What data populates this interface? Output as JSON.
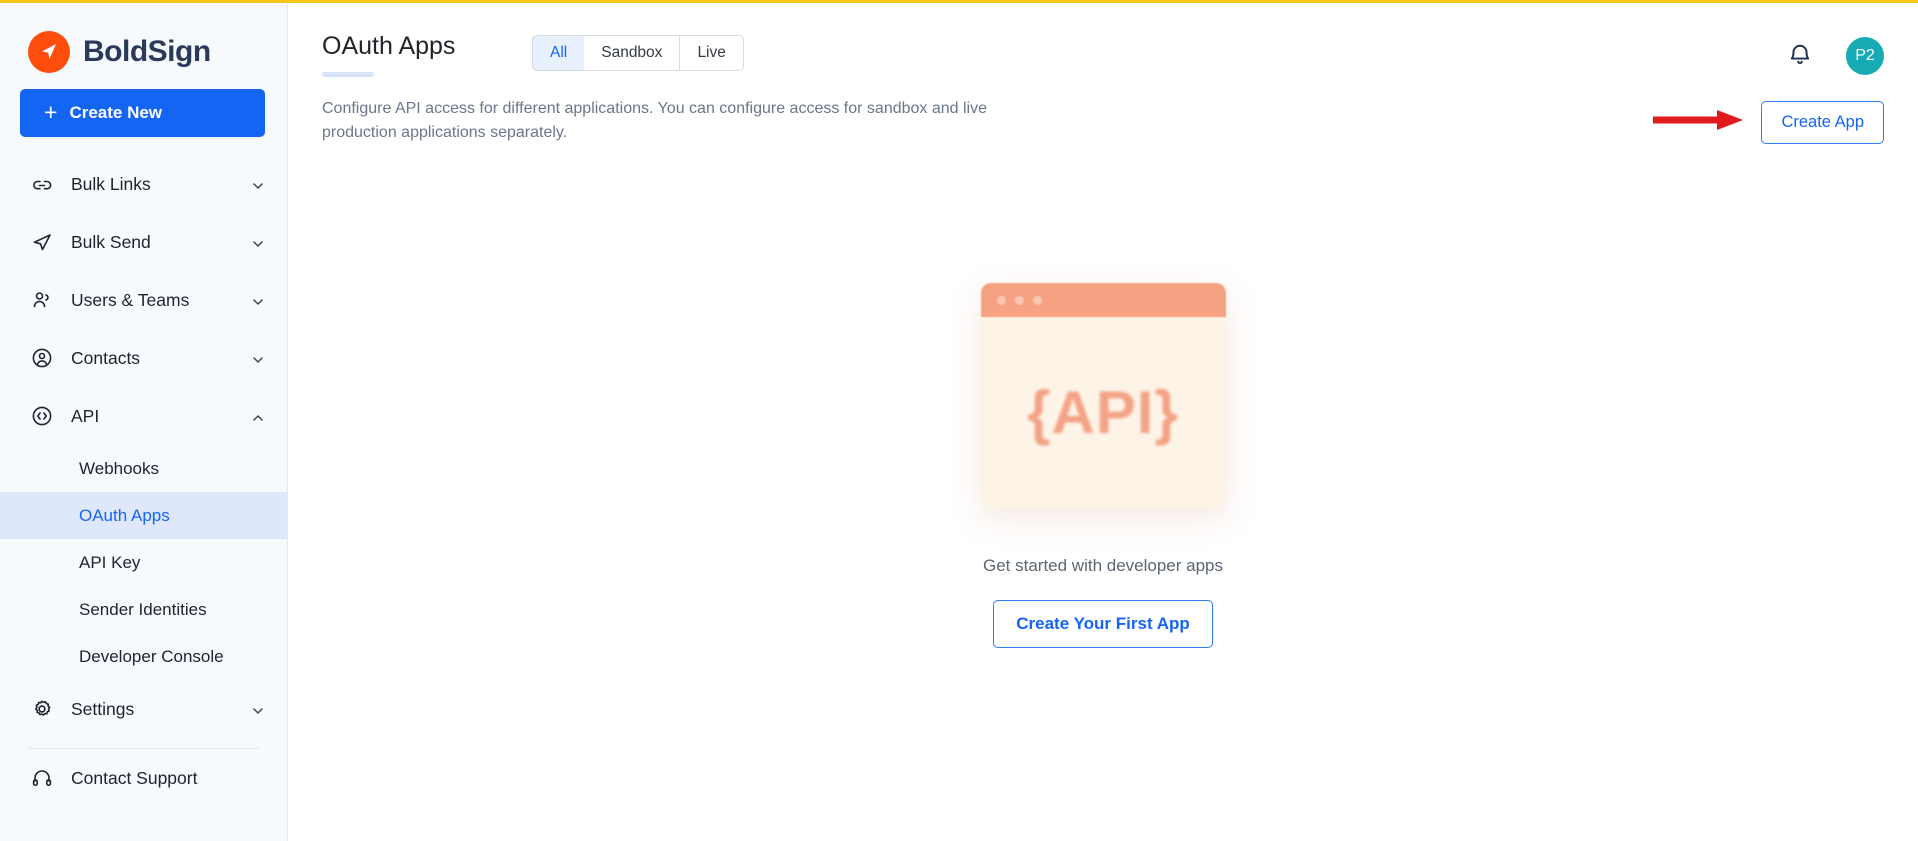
{
  "brand": {
    "name": "BoldSign",
    "logo_icon": "boldsign-arrow-logo"
  },
  "sidebar": {
    "create_new_label": "Create New",
    "items": [
      {
        "label": "Bulk Links",
        "icon": "link-icon",
        "expandable": true
      },
      {
        "label": "Bulk Send",
        "icon": "paper-plane-icon",
        "expandable": true
      },
      {
        "label": "Users & Teams",
        "icon": "users-icon",
        "expandable": true
      },
      {
        "label": "Contacts",
        "icon": "contact-person-icon",
        "expandable": true
      },
      {
        "label": "API",
        "icon": "code-brackets-icon",
        "expandable": true,
        "expanded": true
      }
    ],
    "api_subitems": [
      {
        "label": "Webhooks",
        "active": false
      },
      {
        "label": "OAuth Apps",
        "active": true
      },
      {
        "label": "API Key",
        "active": false
      },
      {
        "label": "Sender Identities",
        "active": false
      },
      {
        "label": "Developer Console",
        "active": false
      }
    ],
    "settings": {
      "label": "Settings",
      "icon": "gear-icon"
    },
    "contact_support": {
      "label": "Contact Support",
      "icon": "headset-icon"
    }
  },
  "header": {
    "title": "OAuth Apps",
    "tabs": [
      {
        "label": "All",
        "active": true
      },
      {
        "label": "Sandbox",
        "active": false
      },
      {
        "label": "Live",
        "active": false
      }
    ],
    "notifications_icon": "bell-icon",
    "avatar_initials": "P2"
  },
  "content": {
    "description": "Configure API access for different applications. You can configure access for sandbox and live production applications separately.",
    "create_app_label": "Create App",
    "annotation_icon": "red-arrow-pointer"
  },
  "empty_state": {
    "illustration_text": "{API}",
    "illustration_icon": "api-browser-window-illustration",
    "message": "Get started with developer apps",
    "button_label": "Create Your First App"
  },
  "colors": {
    "brand_orange": "#ff4d0d",
    "brand_navy": "#2b3a5b",
    "primary_blue": "#1565f5",
    "active_bg": "#dfe8fb",
    "avatar_teal": "#16aab4",
    "annotation_red": "#e01b1b",
    "illustration_coral": "#f7a183"
  }
}
